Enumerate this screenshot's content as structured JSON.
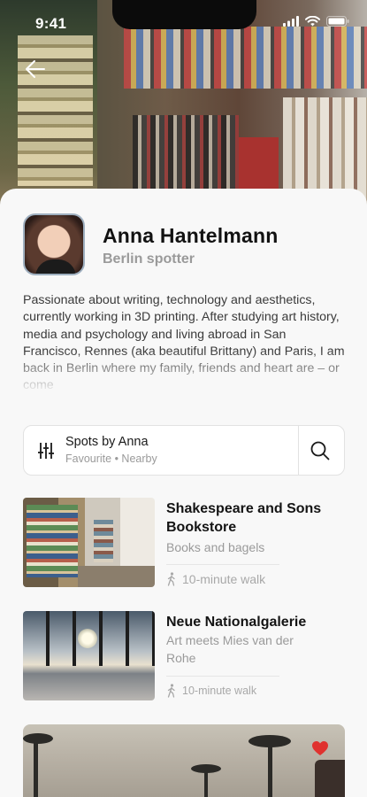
{
  "status": {
    "time": "9:41"
  },
  "profile": {
    "name": "Anna Hantelmann",
    "role": "Berlin spotter",
    "bio": "Passionate about writing, technology and aesthetics, currently working in 3D printing. After studying art history, media and psychology and living abroad in San Francisco, Rennes (aka beautiful Brittany) and Paris, I am back in Berlin where my family, friends and heart are – or come"
  },
  "filter": {
    "title": "Spots by Anna",
    "subtitle": "Favourite • Nearby"
  },
  "spots": [
    {
      "name": "Shakespeare and Sons Bookstore",
      "description": "Books and bagels",
      "walk": "10-minute walk"
    },
    {
      "name": "Neue Nationalgalerie",
      "description": "Art meets Mies van der Rohe",
      "walk": "10-minute walk"
    }
  ],
  "icons": {
    "back": "arrow-left-icon",
    "filter": "sliders-icon",
    "search": "search-icon",
    "walk": "walking-person-icon",
    "favorite": "heart-icon"
  },
  "colors": {
    "favorite": "#e0322f",
    "muted_text": "#9a9a9a"
  }
}
